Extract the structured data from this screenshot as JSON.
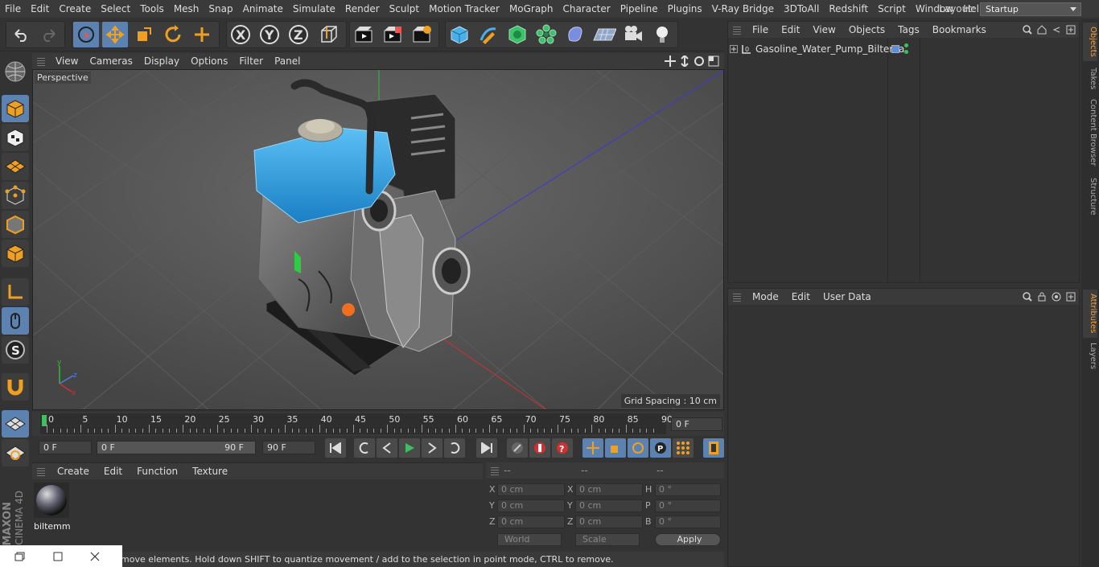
{
  "menubar": {
    "items": [
      "File",
      "Edit",
      "Create",
      "Select",
      "Tools",
      "Mesh",
      "Snap",
      "Animate",
      "Simulate",
      "Render",
      "Sculpt",
      "Motion Tracker",
      "MoGraph",
      "Character",
      "Pipeline",
      "Plugins",
      "V-Ray Bridge",
      "3DToAll",
      "Redshift",
      "Script",
      "Window",
      "Help"
    ],
    "layout_label": "Layout:",
    "layout_value": "Startup"
  },
  "viewport": {
    "menu": [
      "View",
      "Cameras",
      "Display",
      "Options",
      "Filter",
      "Panel"
    ],
    "camera_label": "Perspective",
    "grid_spacing": "Grid Spacing : 10 cm"
  },
  "timeline": {
    "ticks": [
      "0",
      "5",
      "10",
      "15",
      "20",
      "25",
      "30",
      "35",
      "40",
      "45",
      "50",
      "55",
      "60",
      "65",
      "70",
      "75",
      "80",
      "85",
      "90"
    ],
    "current": "0 F"
  },
  "transport": {
    "start": "0 F",
    "range_start": "0 F",
    "range_end": "90 F",
    "end": "90 F"
  },
  "materials": {
    "menu": [
      "Create",
      "Edit",
      "Function",
      "Texture"
    ],
    "items": [
      {
        "name": "biltemm"
      }
    ]
  },
  "coords": {
    "headers": [
      "--",
      "--",
      "--"
    ],
    "rows": [
      {
        "a": "X",
        "av": "0 cm",
        "b": "X",
        "bv": "0 cm",
        "c": "H",
        "cv": "0 °"
      },
      {
        "a": "Y",
        "av": "0 cm",
        "b": "Y",
        "bv": "0 cm",
        "c": "P",
        "cv": "0 °"
      },
      {
        "a": "Z",
        "av": "0 cm",
        "b": "Z",
        "bv": "0 cm",
        "c": "B",
        "cv": "0 °"
      }
    ],
    "space": "World",
    "mode": "Scale",
    "apply": "Apply"
  },
  "objects": {
    "menu": [
      "File",
      "Edit",
      "View",
      "Objects",
      "Tags",
      "Bookmarks"
    ],
    "items": [
      {
        "name": "Gasoline_Water_Pump_Biltema"
      }
    ]
  },
  "attributes": {
    "menu": [
      "Mode",
      "Edit",
      "User Data"
    ]
  },
  "right_tabs": [
    "Objects",
    "Takes",
    "Content Browser",
    "Structure",
    "Attributes",
    "Layers"
  ],
  "status": {
    "text": "move elements. Hold down SHIFT to quantize movement / add to the selection in point mode, CTRL to remove."
  },
  "brand": {
    "line1": "MAXON",
    "line2": "CINEMA 4D"
  },
  "colors": {
    "accent": "#5b82b0",
    "tank": "#2d9be0",
    "selection": "#e8a24a"
  }
}
